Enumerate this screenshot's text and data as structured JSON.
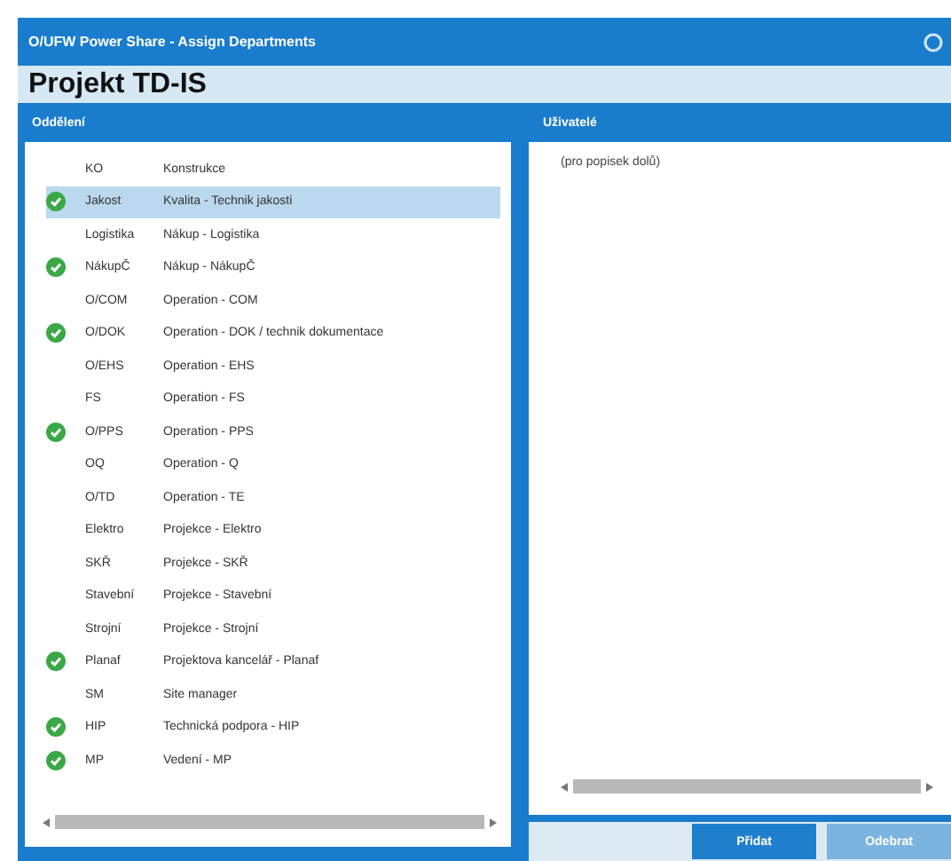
{
  "window": {
    "title": "O/UFW Power Share - Assign Departments"
  },
  "project_title": "Projekt TD-IS",
  "departments": {
    "header": "Oddělení",
    "rows": [
      {
        "code": "KO",
        "name": "Konstrukce",
        "checked": false,
        "selected": false
      },
      {
        "code": "Jakost",
        "name": "Kvalita - Technik jakosti",
        "checked": true,
        "selected": true
      },
      {
        "code": "Logistika",
        "name": "Nákup - Logistika",
        "checked": false,
        "selected": false
      },
      {
        "code": "NákupČ",
        "name": "Nákup - NákupČ",
        "checked": true,
        "selected": false
      },
      {
        "code": "O/COM",
        "name": "Operation - COM",
        "checked": false,
        "selected": false
      },
      {
        "code": "O/DOK",
        "name": "Operation - DOK / technik dokumentace",
        "checked": true,
        "selected": false
      },
      {
        "code": "O/EHS",
        "name": "Operation - EHS",
        "checked": false,
        "selected": false
      },
      {
        "code": "FS",
        "name": "Operation - FS",
        "checked": false,
        "selected": false
      },
      {
        "code": "O/PPS",
        "name": "Operation - PPS",
        "checked": true,
        "selected": false
      },
      {
        "code": "OQ",
        "name": "Operation - Q",
        "checked": false,
        "selected": false
      },
      {
        "code": "O/TD",
        "name": "Operation - TE",
        "checked": false,
        "selected": false
      },
      {
        "code": "Elektro",
        "name": "Projekce - Elektro",
        "checked": false,
        "selected": false
      },
      {
        "code": "SKŘ",
        "name": "Projekce - SKŘ",
        "checked": false,
        "selected": false
      },
      {
        "code": "Stavební",
        "name": "Projekce - Stavební",
        "checked": false,
        "selected": false
      },
      {
        "code": "Strojní",
        "name": "Projekce - Strojní",
        "checked": false,
        "selected": false
      },
      {
        "code": "Planaf",
        "name": "Projektova kancelář - Planaf",
        "checked": true,
        "selected": false
      },
      {
        "code": "SM",
        "name": "Site manager",
        "checked": false,
        "selected": false
      },
      {
        "code": "HIP",
        "name": "Technická podpora - HIP",
        "checked": true,
        "selected": false
      },
      {
        "code": "MP",
        "name": "Vedení - MP",
        "checked": true,
        "selected": false
      }
    ]
  },
  "users": {
    "header": "Uživatelé",
    "empty_item": "(pro popisek dolů)"
  },
  "buttons": [
    {
      "label": "Přidat",
      "kind": "primary"
    },
    {
      "label": "Odebrat",
      "kind": "secondary"
    }
  ]
}
